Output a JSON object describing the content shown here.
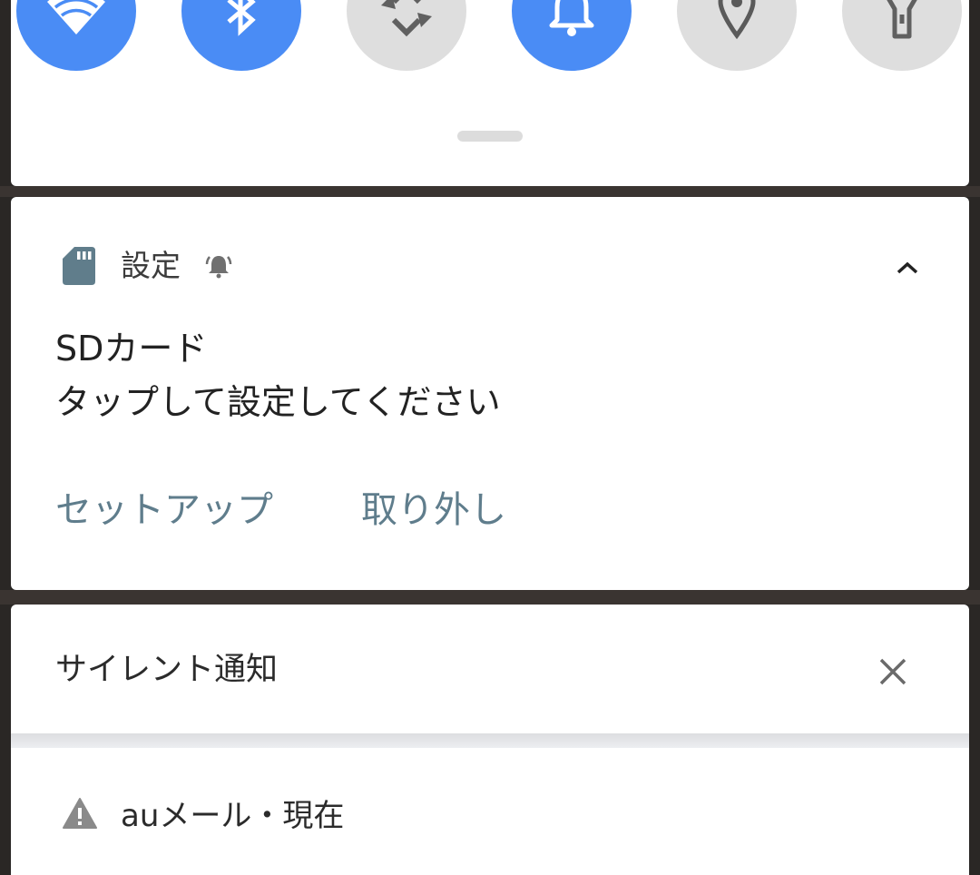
{
  "quick_settings": {
    "tiles": [
      {
        "id": "wifi",
        "icon": "wifi-icon",
        "active": true
      },
      {
        "id": "bluetooth",
        "icon": "bluetooth-icon",
        "active": true
      },
      {
        "id": "auto-rotate",
        "icon": "auto-rotate-icon",
        "active": false
      },
      {
        "id": "sound",
        "icon": "bell-icon",
        "active": true
      },
      {
        "id": "location",
        "icon": "location-pin-icon",
        "active": false
      },
      {
        "id": "flashlight",
        "icon": "flashlight-icon",
        "active": false
      }
    ],
    "colors": {
      "active": "#4a8cf5",
      "inactive": "#dedede"
    }
  },
  "sd_notification": {
    "app_icon": "sd-card-icon",
    "app_name": "設定",
    "alert_icon": "alert-bell-icon",
    "expand_icon": "chevron-up-icon",
    "title": "SDカード",
    "text": "タップして設定してください",
    "actions": {
      "setup": "セットアップ",
      "eject": "取り外し"
    },
    "action_color": "#5f7d8c"
  },
  "silent_section": {
    "label": "サイレント通知",
    "dismiss_icon": "close-icon"
  },
  "au_notification": {
    "icon": "warning-icon",
    "label": "auメール・現在"
  }
}
